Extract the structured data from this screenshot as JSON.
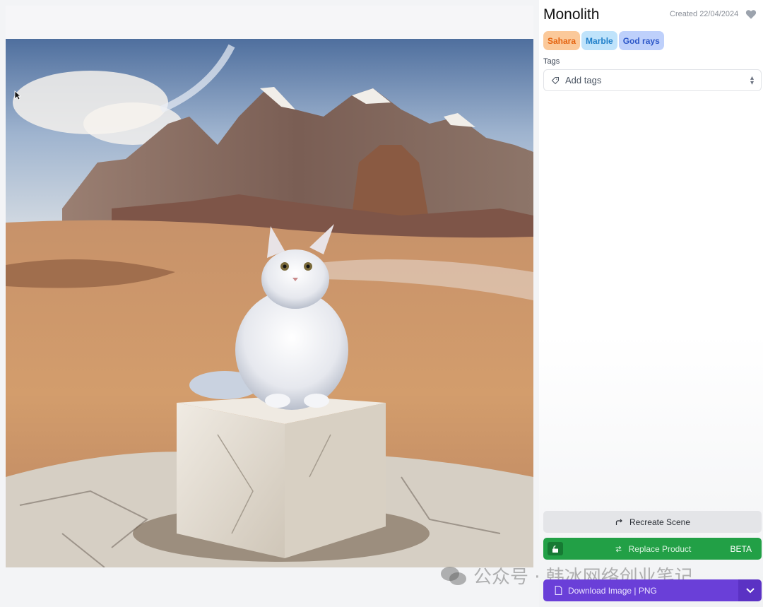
{
  "project": {
    "title": "Monolith",
    "created": "Created 22/04/2024"
  },
  "chips": [
    {
      "label": "Sahara",
      "bg": "#fbc99a",
      "fg": "#e4630f"
    },
    {
      "label": "Marble",
      "bg": "#bfe3fb",
      "fg": "#1f7fc9"
    },
    {
      "label": "God rays",
      "bg": "#bed0fb",
      "fg": "#2d57c8"
    }
  ],
  "tags": {
    "label": "Tags",
    "placeholder": "Add tags"
  },
  "actions": {
    "recreate": "Recreate Scene",
    "replace": "Replace Product",
    "replace_badge": "BETA",
    "download": "Download Image | PNG"
  },
  "watermark": "公众号 · 韩冰网络创业笔记",
  "colors": {
    "green": "#22a046",
    "purple": "#6a3fd8"
  }
}
